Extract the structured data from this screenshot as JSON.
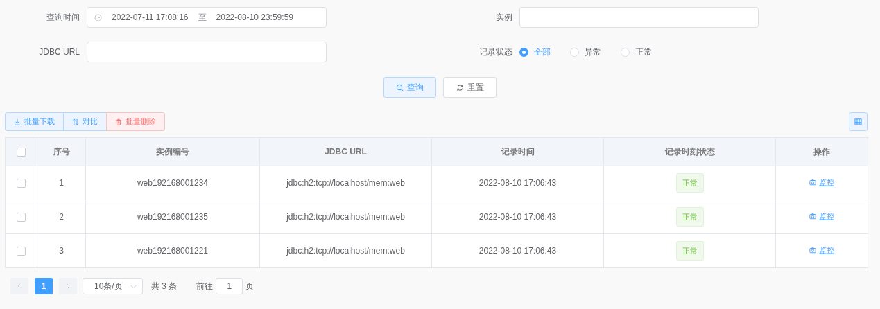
{
  "filters": {
    "query_time": {
      "label": "查询时间",
      "start": "2022-07-11 17:08:16",
      "separator": "至",
      "end": "2022-08-10 23:59:59"
    },
    "instance": {
      "label": "实例"
    },
    "jdbc_url": {
      "label": "JDBC URL"
    },
    "record_status": {
      "label": "记录状态",
      "options": [
        {
          "label": "全部",
          "selected": true
        },
        {
          "label": "异常",
          "selected": false
        },
        {
          "label": "正常",
          "selected": false
        }
      ]
    }
  },
  "actions": [
    {
      "label": "查询",
      "kind": "search"
    },
    {
      "label": "重置",
      "kind": "reset"
    }
  ],
  "toolbar": [
    {
      "label": "批量下载",
      "kind": "download"
    },
    {
      "label": "对比",
      "kind": "compare"
    },
    {
      "label": "批量删除",
      "kind": "delete"
    }
  ],
  "table": {
    "header_checked": false,
    "columns": [
      "序号",
      "实例编号",
      "JDBC URL",
      "记录时间",
      "记录时刻状态",
      "操作"
    ],
    "rows": [
      {
        "checked": false,
        "index": "1",
        "instance": "web192168001234",
        "url": "jdbc:h2:tcp://localhost/mem:web",
        "time": "2022-08-10 17:06:43",
        "status": "正常",
        "action": "监控"
      },
      {
        "checked": false,
        "index": "2",
        "instance": "web192168001235",
        "url": "jdbc:h2:tcp://localhost/mem:web",
        "time": "2022-08-10 17:06:43",
        "status": "正常",
        "action": "监控"
      },
      {
        "checked": false,
        "index": "3",
        "instance": "web192168001221",
        "url": "jdbc:h2:tcp://localhost/mem:web",
        "time": "2022-08-10 17:06:43",
        "status": "正常",
        "action": "监控"
      }
    ]
  },
  "pagination": {
    "page": "1",
    "page_size": "10条/页",
    "total": "共 3 条",
    "goto_label": "前往",
    "goto_value": "1",
    "goto_suffix": "页"
  }
}
